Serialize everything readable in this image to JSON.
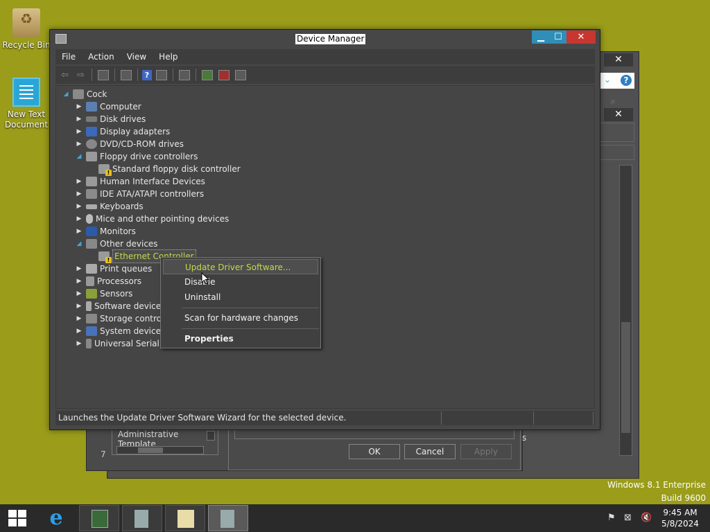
{
  "desktop": {
    "recycle_bin": "Recycle Bin",
    "new_text_doc_line1": "New Text",
    "new_text_doc_line2": "Document"
  },
  "window": {
    "title": "Device Manager",
    "menu": [
      "File",
      "Action",
      "View",
      "Help"
    ]
  },
  "tree": {
    "root": "Cock",
    "items": [
      {
        "label": "Computer",
        "expanded": false
      },
      {
        "label": "Disk drives",
        "expanded": false
      },
      {
        "label": "Display adapters",
        "expanded": false
      },
      {
        "label": "DVD/CD-ROM drives",
        "expanded": false
      },
      {
        "label": "Floppy drive controllers",
        "expanded": true
      },
      {
        "label": "Standard floppy disk controller",
        "child": true
      },
      {
        "label": "Human Interface Devices",
        "expanded": false
      },
      {
        "label": "IDE ATA/ATAPI controllers",
        "expanded": false
      },
      {
        "label": "Keyboards",
        "expanded": false
      },
      {
        "label": "Mice and other pointing devices",
        "expanded": false
      },
      {
        "label": "Monitors",
        "expanded": false
      },
      {
        "label": "Other devices",
        "expanded": true
      },
      {
        "label": "Ethernet Controller",
        "child": true,
        "selected": true
      },
      {
        "label": "Print queues",
        "expanded": false
      },
      {
        "label": "Processors",
        "expanded": false
      },
      {
        "label": "Sensors",
        "expanded": false
      },
      {
        "label": "Software devices",
        "expanded": false
      },
      {
        "label": "Storage controllers",
        "expanded": false
      },
      {
        "label": "System devices",
        "expanded": false
      },
      {
        "label": "Universal Serial Bus controllers",
        "expanded": false
      }
    ]
  },
  "context_menu": {
    "update_driver": "Update Driver Software...",
    "disable": "Disable",
    "uninstall": "Uninstall",
    "scan": "Scan for hardware changes",
    "properties": "Properties"
  },
  "status_bar": {
    "text": "Launches the Update Driver Software Wizard for the selected device."
  },
  "background_dialog": {
    "admin_templates": "Administrative Template",
    "ok": "OK",
    "cancel": "Cancel",
    "apply": "Apply",
    "left_digit": "7",
    "side_char": "s"
  },
  "watermark": {
    "line1": "Windows 8.1 Enterprise",
    "line2": "Build 9600"
  },
  "taskbar": {
    "time": "9:45 AM",
    "date": "5/8/2024"
  },
  "colors": {
    "desktop": "#9a9c1a",
    "highlight_text": "#c7d84a",
    "close_button": "#c7372f",
    "title_buttons": "#2f8fb8"
  }
}
